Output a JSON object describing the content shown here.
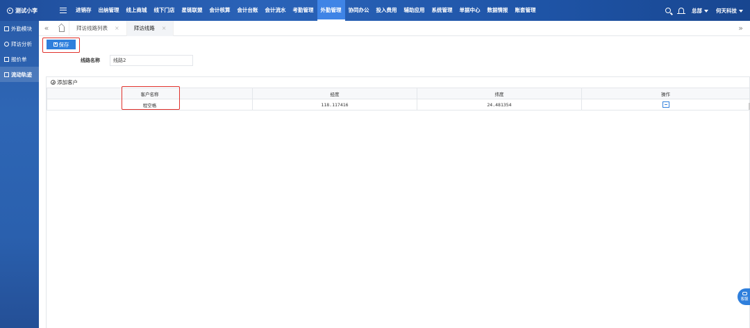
{
  "topnav": {
    "brand": "测试小李",
    "items": [
      "进销存",
      "出纳管理",
      "线上商城",
      "线下门店",
      "星链联盟",
      "会计核算",
      "会计台账",
      "会计流水",
      "考勤管理",
      "外勤管理",
      "协同办公",
      "投入费用",
      "辅助应用",
      "系统管理",
      "单据中心",
      "数据情报",
      "账套管理"
    ],
    "active_item": "外勤管理",
    "right_hq": "总部",
    "right_company": "何天科技"
  },
  "sidebar": {
    "items": [
      "外勤模块",
      "拜访分析",
      "报价单",
      "流动轨迹"
    ],
    "active_item": "流动轨迹"
  },
  "tabs": {
    "items": [
      {
        "label": "拜访线路列表",
        "close": "×"
      },
      {
        "label": "拜访线路",
        "close": "×"
      }
    ],
    "active": 1,
    "left_arrow": "«",
    "right_arrow": "»"
  },
  "toolbar": {
    "save_label": "保存"
  },
  "form": {
    "route_name_label": "线路名称",
    "route_name_value": "线路2"
  },
  "section": {
    "add_customer_label": "添加客户"
  },
  "table": {
    "headers": [
      "客户名称",
      "经度",
      "纬度",
      "操作"
    ],
    "rows": [
      {
        "name": "程空格",
        "longitude": "118.117416",
        "latitude": "24.481354"
      }
    ]
  },
  "widget": {
    "label": "客服"
  },
  "colors": {
    "nav_bg": "#2a63b8",
    "primary": "#2f7fdc",
    "highlight_box": "#e0312b"
  }
}
